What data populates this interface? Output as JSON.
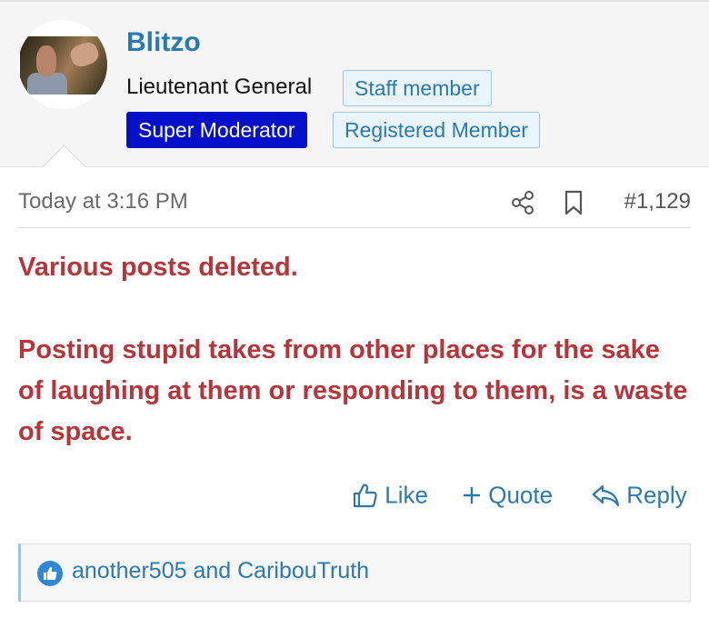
{
  "user": {
    "name": "Blitzo",
    "title": "Lieutenant General",
    "badges": {
      "staff": "Staff member",
      "super_moderator": "Super Moderator",
      "registered": "Registered Member"
    }
  },
  "post": {
    "timestamp": "Today at 3:16 PM",
    "number": "#1,129",
    "paragraphs": [
      "Various posts deleted.",
      "Posting stupid takes from other places for the sake of laughing at them or responding to them, is a waste of space."
    ]
  },
  "actions": {
    "like": "Like",
    "quote": "Quote",
    "reply": "Reply"
  },
  "reactions": {
    "text": "another505 and CaribouTruth"
  },
  "icons": {
    "share": "share-icon",
    "bookmark": "bookmark-icon",
    "like": "thumbs-up-icon",
    "quote": "plus-icon",
    "reply": "reply-arrow-icon"
  },
  "colors": {
    "link": "#2c78b0",
    "super_moderator_bg": "#0511c9",
    "moderator_text": "#b5353a"
  }
}
